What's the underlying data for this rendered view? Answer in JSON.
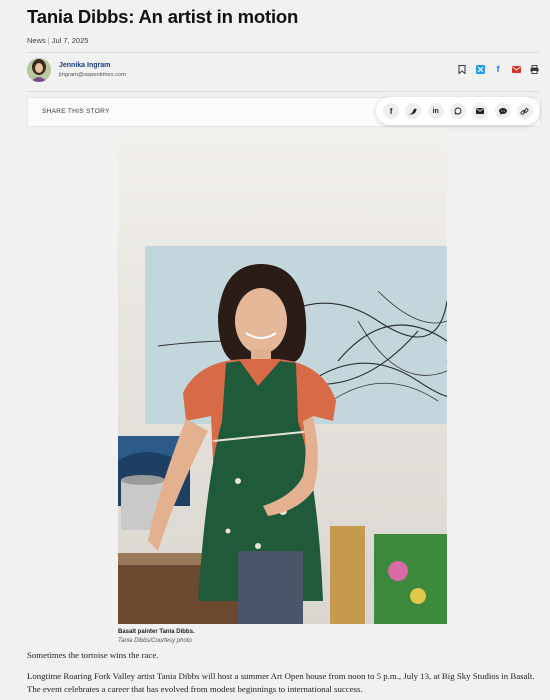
{
  "article": {
    "title": "Tania Dibbs: An artist in motion",
    "section": "News",
    "date": "Jul 7, 2025"
  },
  "author": {
    "name": "Jennika Ingram",
    "email": "jingram@aspentimes.com"
  },
  "share": {
    "label": "SHARE THIS STORY",
    "buttons": [
      "f",
      "twitter-icon",
      "in",
      "whatsapp-icon",
      "email-icon",
      "sms-icon",
      "link-icon"
    ]
  },
  "photo": {
    "caption": "Basalt painter Tania Dibbs.",
    "credit": "Tania Dibbs/Courtesy photo"
  },
  "body": {
    "p1": "Sometimes the tortoise wins the race.",
    "p2": "Longtime Roaring Fork Valley artist Tania Dibbs will host a summer Art Open house from noon to 5 p.m., July 13, at Big Sky Studios in Basalt. The event celebrates a career that has evolved from modest beginnings to international success."
  },
  "colors": {
    "author_link": "#1a3a7c",
    "twitter": "#1d9bf0",
    "facebook": "#1877f2",
    "email_red": "#d93025"
  }
}
